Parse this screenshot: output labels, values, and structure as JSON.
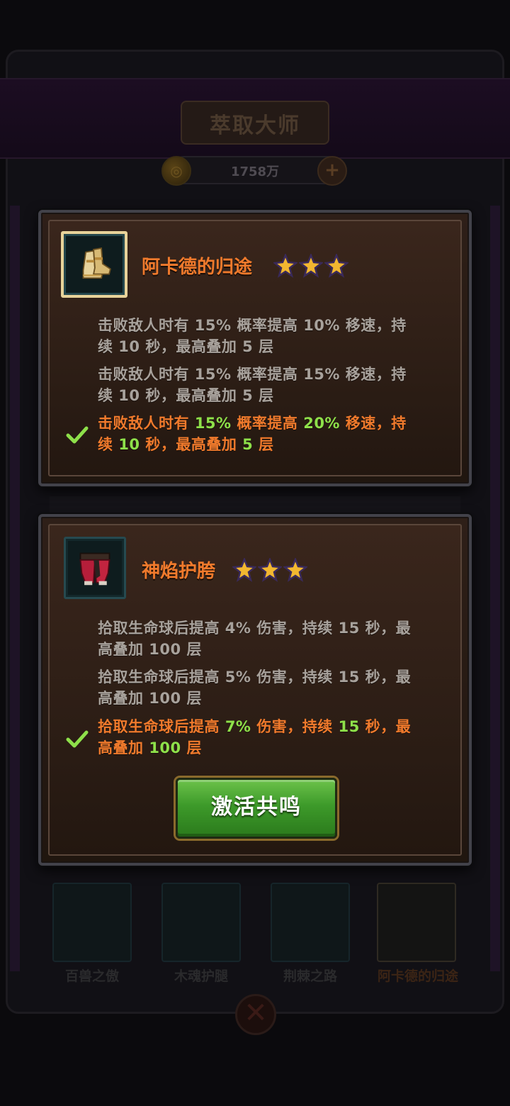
{
  "background": {
    "title": "萃取大师",
    "currency": "1758万",
    "slots": [
      {
        "label": "百兽之傲",
        "active": false
      },
      {
        "label": "木魂护腿",
        "active": false
      },
      {
        "label": "荆棘之路",
        "active": false
      },
      {
        "label": "阿卡德的归途",
        "active": true
      }
    ]
  },
  "panels": [
    {
      "name": "阿卡德的归途",
      "stars": 3,
      "icon": "boots-icon",
      "effects": [
        {
          "line1": "击败敌人时有 15% 概率提高 10% 移速，持",
          "line2": "续 10 秒，最高叠加 5 层",
          "active": false
        },
        {
          "line1": "击败敌人时有 15% 概率提高 15% 移速，持",
          "line2": "续 10 秒，最高叠加 5 层",
          "active": false
        },
        {
          "active": true,
          "parts1": [
            "击败敌人时有 ",
            "15%",
            " 概率提高 ",
            "20%",
            " 移速，持"
          ],
          "parts2": [
            "续 ",
            "10",
            " 秒，最高叠加 ",
            "5",
            " 层"
          ]
        }
      ]
    },
    {
      "name": "神焰护胯",
      "stars": 3,
      "icon": "pants-icon",
      "effects": [
        {
          "line1": "拾取生命球后提高 4% 伤害，持续 15 秒，最",
          "line2": "高叠加 100 层",
          "active": false
        },
        {
          "line1": "拾取生命球后提高 5% 伤害，持续 15 秒，最",
          "line2": "高叠加 100 层",
          "active": false
        },
        {
          "active": true,
          "parts1": [
            "拾取生命球后提高 ",
            "7%",
            " 伤害，持续 ",
            "15",
            " 秒，最"
          ],
          "parts2": [
            "高叠加 ",
            "100",
            " 层"
          ]
        }
      ],
      "button_label": "激活共鸣"
    }
  ],
  "colors": {
    "active_text": "#f07a2c",
    "highlight": "#8ee04a",
    "inactive_text": "#a8a29c",
    "button": "#3d9a2a"
  }
}
